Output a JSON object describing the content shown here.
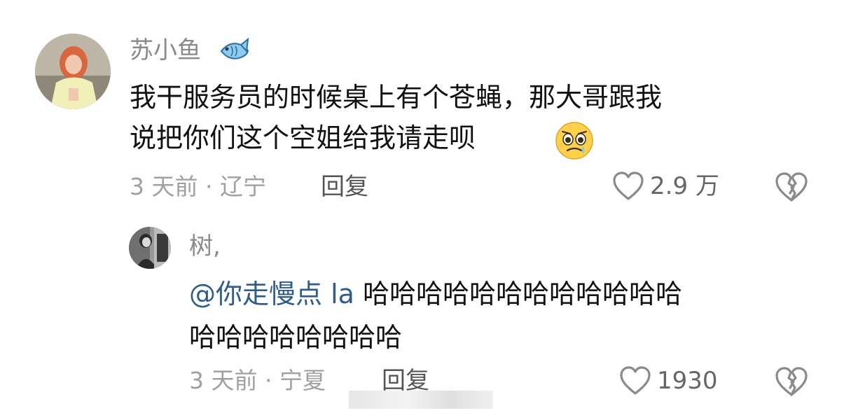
{
  "main_comment": {
    "username": "苏小鱼",
    "username_icon": "fish-icon",
    "text_line1": "我干服务员的时候桌上有个苍蝇，那大哥跟我",
    "text_line2": "说把你们这个空姐给我请走呗",
    "trailing_emoji": "pleading-face-emoji",
    "meta": "3 天前 · 辽宁",
    "reply_label": "回复",
    "like_icon": "heart-outline-icon",
    "like_count": "2.9 万",
    "dislike_icon": "broken-heart-icon"
  },
  "reply_comment": {
    "username": "树,",
    "mention": "@你走慢点 la",
    "text_line1_rest": " 哈哈哈哈哈哈哈哈哈哈哈哈",
    "text_line2": "哈哈哈哈哈哈哈哈",
    "meta": "3 天前 · 宁夏",
    "reply_label": "回复",
    "like_icon": "heart-outline-icon",
    "like_count": "1930",
    "dislike_icon": "broken-heart-icon"
  },
  "colors": {
    "username": "#8a8a8a",
    "body_text": "#111111",
    "mention": "#2f5d8a",
    "meta": "#a0a0a0"
  }
}
